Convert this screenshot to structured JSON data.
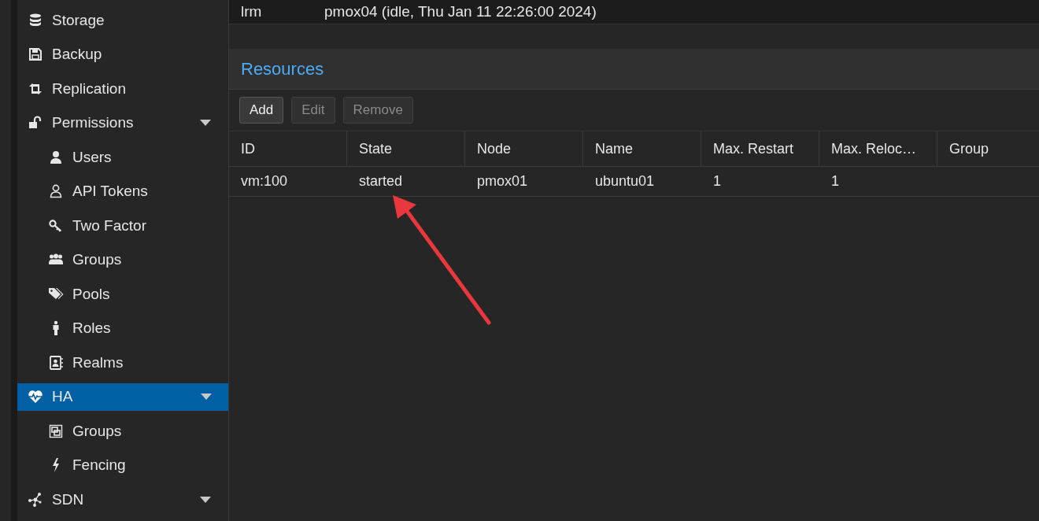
{
  "sidebar": {
    "items": [
      {
        "label": "Storage",
        "selected": false
      },
      {
        "label": "Backup",
        "selected": false
      },
      {
        "label": "Replication",
        "selected": false
      },
      {
        "label": "Permissions",
        "selected": false,
        "expanded": true,
        "children": [
          {
            "label": "Users",
            "selected": false
          },
          {
            "label": "API Tokens",
            "selected": false
          },
          {
            "label": "Two Factor",
            "selected": false
          },
          {
            "label": "Groups",
            "selected": false
          },
          {
            "label": "Pools",
            "selected": false
          },
          {
            "label": "Roles",
            "selected": false
          },
          {
            "label": "Realms",
            "selected": false
          }
        ]
      },
      {
        "label": "HA",
        "selected": true,
        "expanded": true,
        "children": [
          {
            "label": "Groups",
            "selected": false
          },
          {
            "label": "Fencing",
            "selected": false
          }
        ]
      },
      {
        "label": "SDN",
        "selected": false,
        "expanded": true
      }
    ]
  },
  "status_row": {
    "key": "lrm",
    "value": "pmox04 (idle, Thu Jan 11 22:26:00 2024)"
  },
  "resources": {
    "title": "Resources",
    "buttons": [
      {
        "label": "Add",
        "disabled": false
      },
      {
        "label": "Edit",
        "disabled": true
      },
      {
        "label": "Remove",
        "disabled": true
      }
    ],
    "table": {
      "columns": [
        "ID",
        "State",
        "Node",
        "Name",
        "Max. Restart",
        "Max. Reloc…",
        "Group"
      ],
      "rows": [
        [
          "vm:100",
          "started",
          "pmox01",
          "ubuntu01",
          "1",
          "1",
          ""
        ]
      ]
    }
  }
}
